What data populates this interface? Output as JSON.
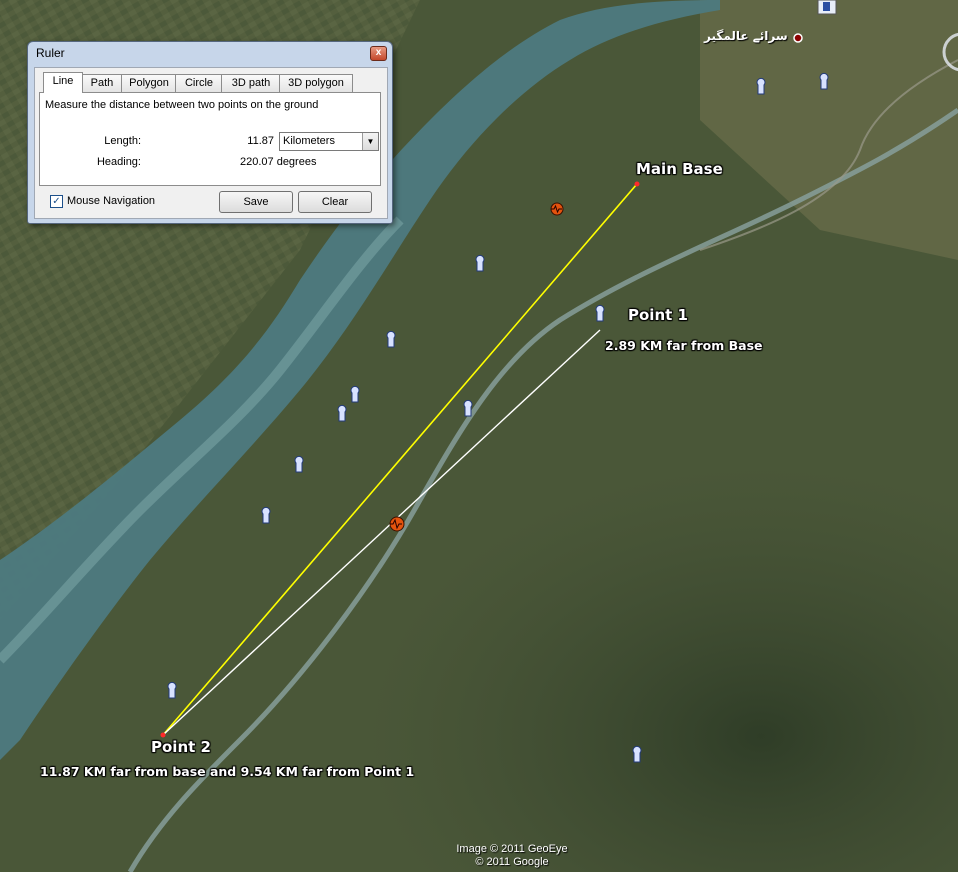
{
  "ruler": {
    "title": "Ruler",
    "close_glyph": "x",
    "tabs": [
      "Line",
      "Path",
      "Polygon",
      "Circle",
      "3D path",
      "3D polygon"
    ],
    "active_tab": "Line",
    "description": "Measure the distance between two points on the ground",
    "length_label": "Length:",
    "length_value": "11.87",
    "unit_selected": "Kilometers",
    "heading_label": "Heading:",
    "heading_value": "220.07 degrees",
    "mouse_navigation_label": "Mouse Navigation",
    "mouse_navigation_checked": true,
    "save_label": "Save",
    "clear_label": "Clear"
  },
  "map": {
    "main_base_label": "Main Base",
    "point1_label": "Point 1",
    "point1_note": "2.89 KM far from Base",
    "point2_label": "Point 2",
    "point2_note": "11.87 KM far from base and 9.54 KM far from Point 1",
    "place_label_urdu": "سرائے عالمگیر",
    "copyright_line1": "Image © 2011 GeoEye",
    "copyright_line2": "© 2011 Google",
    "measure_line_color": "#ffff00",
    "secondary_line_color": "#ffffff",
    "river_color": "#4d7a80",
    "terrain_color": "#4a5738"
  }
}
